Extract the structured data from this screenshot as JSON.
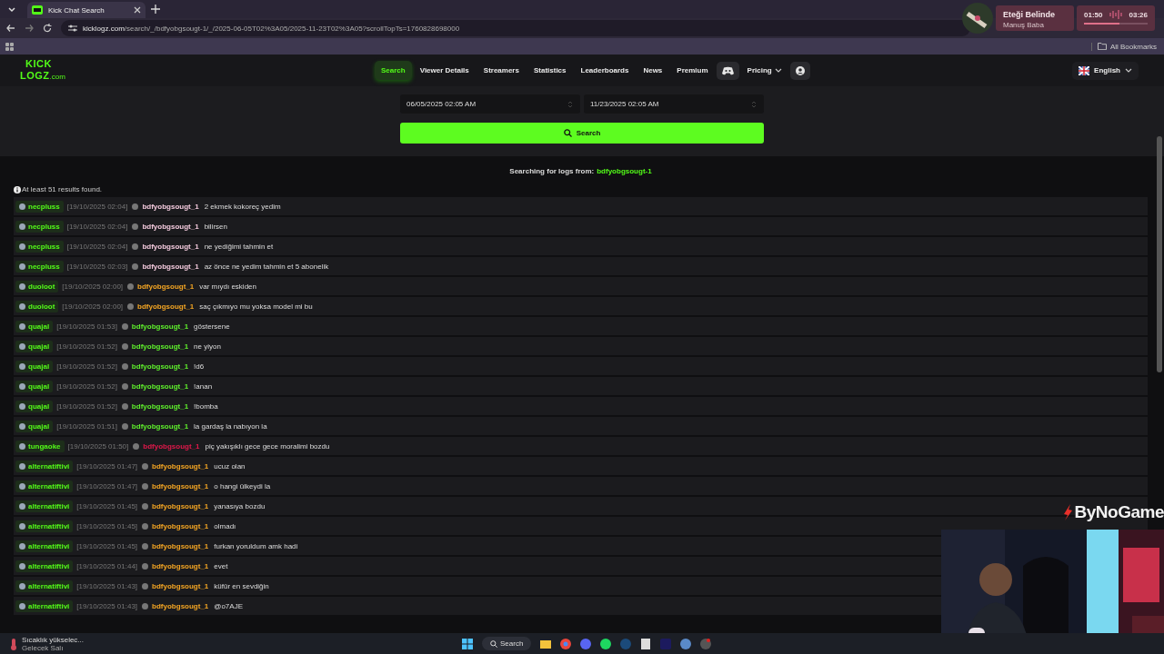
{
  "browser": {
    "tab_title": "Kick Chat Search",
    "url": "kicklogz.com/search/_/bdfyobgsougt-1/_/2025-06-05T02%3A05/2025-11-23T02%3A05?scrollTopTs=1760828698000",
    "bookmarks_label": "All Bookmarks"
  },
  "media": {
    "title": "Eteği Belinde",
    "artist": "Manuş Baba",
    "elapsed": "01:50",
    "total": "03:26",
    "level": 0.55
  },
  "site": {
    "logo_top": "KICK",
    "logo_bottom": "LOGZ",
    "logo_suffix": ".com",
    "nav": [
      {
        "label": "Search",
        "selected": true,
        "kind": "text"
      },
      {
        "label": "Viewer Details",
        "selected": false,
        "kind": "text"
      },
      {
        "label": "Streamers",
        "selected": false,
        "kind": "text"
      },
      {
        "label": "Statistics",
        "selected": false,
        "kind": "text"
      },
      {
        "label": "Leaderboards",
        "selected": false,
        "kind": "text"
      },
      {
        "label": "News",
        "selected": false,
        "kind": "text"
      },
      {
        "label": "Premium",
        "selected": false,
        "kind": "text"
      },
      {
        "kind": "discord",
        "selected": false
      },
      {
        "label": "Pricing",
        "selected": false,
        "kind": "dropdown"
      },
      {
        "kind": "account",
        "selected": false
      }
    ],
    "language": "English"
  },
  "form": {
    "from_value": "06/05/2025 02:05 AM",
    "to_value": "11/23/2025 02:05 AM",
    "search_button": "Search"
  },
  "results": {
    "searching_prefix": "Searching for logs from:",
    "searching_user": "bdfyobgsougt-1",
    "count": "At least 51 results found.",
    "rows": [
      {
        "channel": "necpluss",
        "time": "[19/10/2025 02:04]",
        "user": "bdfyobgsougt_1",
        "message": "2 ekmek kokoreç yedim",
        "color": "#f3c9dc"
      },
      {
        "channel": "necpluss",
        "time": "[19/10/2025 02:04]",
        "user": "bdfyobgsougt_1",
        "message": "bilirsen",
        "color": "#f3c9dc"
      },
      {
        "channel": "necpluss",
        "time": "[19/10/2025 02:04]",
        "user": "bdfyobgsougt_1",
        "message": "ne yediğimi tahmin et",
        "color": "#f3c9dc"
      },
      {
        "channel": "necpluss",
        "time": "[19/10/2025 02:03]",
        "user": "bdfyobgsougt_1",
        "message": "az önce ne yedim tahmin et 5 abonelik",
        "color": "#f3c9dc"
      },
      {
        "channel": "duoloot",
        "time": "[19/10/2025 02:00]",
        "user": "bdfyobgsougt_1",
        "message": "var mıydı eskiden",
        "color": "#f5a623"
      },
      {
        "channel": "duoloot",
        "time": "[19/10/2025 02:00]",
        "user": "bdfyobgsougt_1",
        "message": "saç çıkmıyo mu yoksa model mi bu",
        "color": "#f5a623"
      },
      {
        "channel": "quajal",
        "time": "[19/10/2025 01:53]",
        "user": "bdfyobgsougt_1",
        "message": "göstersene",
        "color": "#5ff02c"
      },
      {
        "channel": "quajal",
        "time": "[19/10/2025 01:52]",
        "user": "bdfyobgsougt_1",
        "message": "ne yiyon",
        "color": "#5ff02c"
      },
      {
        "channel": "quajal",
        "time": "[19/10/2025 01:52]",
        "user": "bdfyobgsougt_1",
        "message": "!d6",
        "color": "#5ff02c"
      },
      {
        "channel": "quajal",
        "time": "[19/10/2025 01:52]",
        "user": "bdfyobgsougt_1",
        "message": "!anan",
        "color": "#5ff02c"
      },
      {
        "channel": "quajal",
        "time": "[19/10/2025 01:52]",
        "user": "bdfyobgsougt_1",
        "message": "!bomba",
        "color": "#5ff02c"
      },
      {
        "channel": "quajal",
        "time": "[19/10/2025 01:51]",
        "user": "bdfyobgsougt_1",
        "message": "la gardaş la nabıyon la",
        "color": "#5ff02c"
      },
      {
        "channel": "tungaoke",
        "time": "[19/10/2025 01:50]",
        "user": "bdfyobgsougt_1",
        "message": "piç yakışıklı gece gece moralimi bozdu",
        "color": "#e0184a"
      },
      {
        "channel": "alternatiftivi",
        "time": "[19/10/2025 01:47]",
        "user": "bdfyobgsougt_1",
        "message": "ucuz olan",
        "color": "#f5a623"
      },
      {
        "channel": "alternatiftivi",
        "time": "[19/10/2025 01:47]",
        "user": "bdfyobgsougt_1",
        "message": "o hangi ülkeydi la",
        "color": "#f5a623"
      },
      {
        "channel": "alternatiftivi",
        "time": "[19/10/2025 01:45]",
        "user": "bdfyobgsougt_1",
        "message": "yanasıya bozdu",
        "color": "#f5a623"
      },
      {
        "channel": "alternatiftivi",
        "time": "[19/10/2025 01:45]",
        "user": "bdfyobgsougt_1",
        "message": "olmadı",
        "color": "#f5a623"
      },
      {
        "channel": "alternatiftivi",
        "time": "[19/10/2025 01:45]",
        "user": "bdfyobgsougt_1",
        "message": "furkan yoruldum amk hadi",
        "color": "#f5a623"
      },
      {
        "channel": "alternatiftivi",
        "time": "[19/10/2025 01:44]",
        "user": "bdfyobgsougt_1",
        "message": "evet",
        "color": "#f5a623"
      },
      {
        "channel": "alternatiftivi",
        "time": "[19/10/2025 01:43]",
        "user": "bdfyobgsougt_1",
        "message": "küfür en sevdiğin",
        "color": "#f5a623"
      },
      {
        "channel": "alternatiftivi",
        "time": "[19/10/2025 01:43]",
        "user": "bdfyobgsougt_1",
        "message": "@o7AJE",
        "color": "#f5a623"
      }
    ]
  },
  "overlay": {
    "brand": "ByNoGame"
  },
  "taskbar": {
    "weather_title": "Sıcaklık yükselec...",
    "weather_sub": "Gelecek Salı",
    "search": "Search"
  }
}
